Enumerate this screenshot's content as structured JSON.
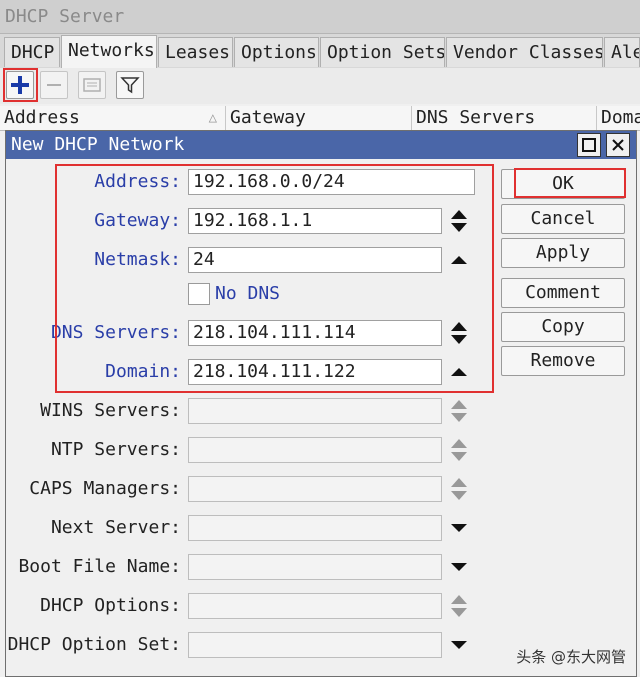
{
  "window": {
    "title": "DHCP Server"
  },
  "tabs": [
    "DHCP",
    "Networks",
    "Leases",
    "Options",
    "Option Sets",
    "Vendor Classes",
    "Ale"
  ],
  "table": {
    "columns": [
      "Address",
      "Gateway",
      "DNS Servers",
      "Doma"
    ]
  },
  "dialog": {
    "title": "New DHCP Network",
    "fields": {
      "address": {
        "label": "Address:",
        "value": "192.168.0.0/24"
      },
      "gateway": {
        "label": "Gateway:",
        "value": "192.168.1.1"
      },
      "netmask": {
        "label": "Netmask:",
        "value": "24"
      },
      "no_dns": {
        "label": "No DNS",
        "checked": false
      },
      "dns_servers": {
        "label": "DNS Servers:",
        "value": "218.104.111.114"
      },
      "domain": {
        "label": "Domain:",
        "value": "218.104.111.122"
      },
      "wins_servers": {
        "label": "WINS Servers:",
        "value": ""
      },
      "ntp_servers": {
        "label": "NTP Servers:",
        "value": ""
      },
      "caps_managers": {
        "label": "CAPS Managers:",
        "value": ""
      },
      "next_server": {
        "label": "Next Server:",
        "value": ""
      },
      "boot_file_name": {
        "label": "Boot File Name:",
        "value": ""
      },
      "dhcp_options": {
        "label": "DHCP Options:",
        "value": ""
      },
      "dhcp_option_set": {
        "label": "DHCP Option Set:",
        "value": ""
      }
    },
    "buttons": {
      "ok": "OK",
      "cancel": "Cancel",
      "apply": "Apply",
      "comment": "Comment",
      "copy": "Copy",
      "remove": "Remove"
    }
  },
  "watermark": "头条 @东大网管",
  "colors": {
    "title_bar": "#4a66a8",
    "highlight": "#e03030",
    "field_label": "#2a3ea8"
  }
}
